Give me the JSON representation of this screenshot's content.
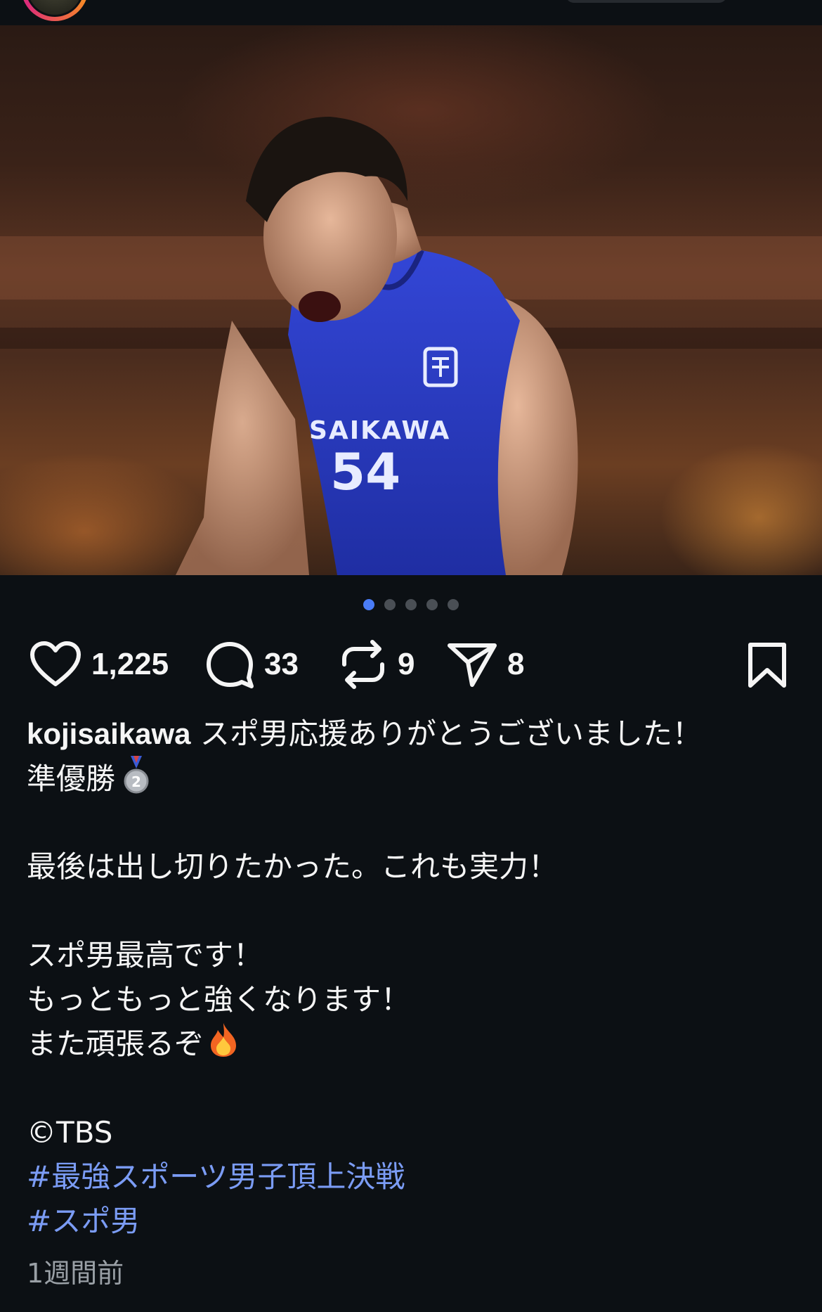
{
  "post": {
    "image_carousel": {
      "total": 5,
      "active_index": 0
    },
    "actions": {
      "likes": "1,225",
      "comments": "33",
      "reposts": "9",
      "shares": "8"
    },
    "jersey": {
      "name": "SAIKAWA",
      "number": "54"
    },
    "caption": {
      "username": "kojisaikawa",
      "line1": "スポ男応援ありがとうございました！",
      "line2": "準優勝",
      "line3": "最後は出し切りたかった。これも実力！",
      "line4": "スポ男最高です！",
      "line5": "もっともっと強くなります！",
      "line6": "また頑張るぞ",
      "line7": "©TBS",
      "hashtags": [
        "#最強スポーツ男子頂上決戦",
        "#スポ男"
      ]
    },
    "timestamp": "1週間前"
  },
  "icons": {
    "like": "heart-icon",
    "comment": "comment-bubble-icon",
    "repost": "repost-icon",
    "share": "paper-plane-icon",
    "save": "bookmark-icon",
    "medal": "second-place-medal-icon",
    "fire": "fire-icon"
  },
  "colors": {
    "background": "#0c1014",
    "text": "#f5f5f5",
    "hashtag": "#7b9cf5",
    "active_dot": "#4a7cf6",
    "muted": "#9aa0a6",
    "jersey": "#2d3fc4"
  }
}
